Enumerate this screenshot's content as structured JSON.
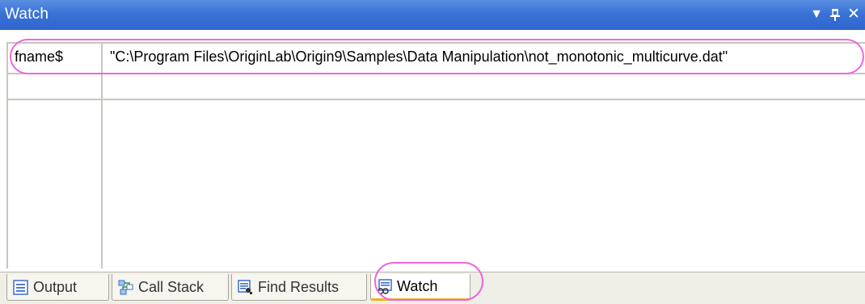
{
  "window": {
    "title": "Watch",
    "buttons": [
      "dropdown",
      "pin",
      "close"
    ]
  },
  "watch_table": {
    "rows": [
      {
        "name": "fname$",
        "value": "\"C:\\Program Files\\OriginLab\\Origin9\\Samples\\Data Manipulation\\not_monotonic_multicurve.dat\""
      },
      {
        "name": "",
        "value": ""
      }
    ]
  },
  "tabs": [
    {
      "label": "Output",
      "icon": "output-icon",
      "selected": false
    },
    {
      "label": "Call Stack",
      "icon": "call-stack-icon",
      "selected": false
    },
    {
      "label": "Find Results",
      "icon": "find-results-icon",
      "selected": false
    },
    {
      "label": "Watch",
      "icon": "watch-icon",
      "selected": true
    }
  ],
  "colors": {
    "titlebar": "#3a72d8",
    "highlight": "#ee66e0",
    "active_tab_underline": "#f0b020"
  }
}
